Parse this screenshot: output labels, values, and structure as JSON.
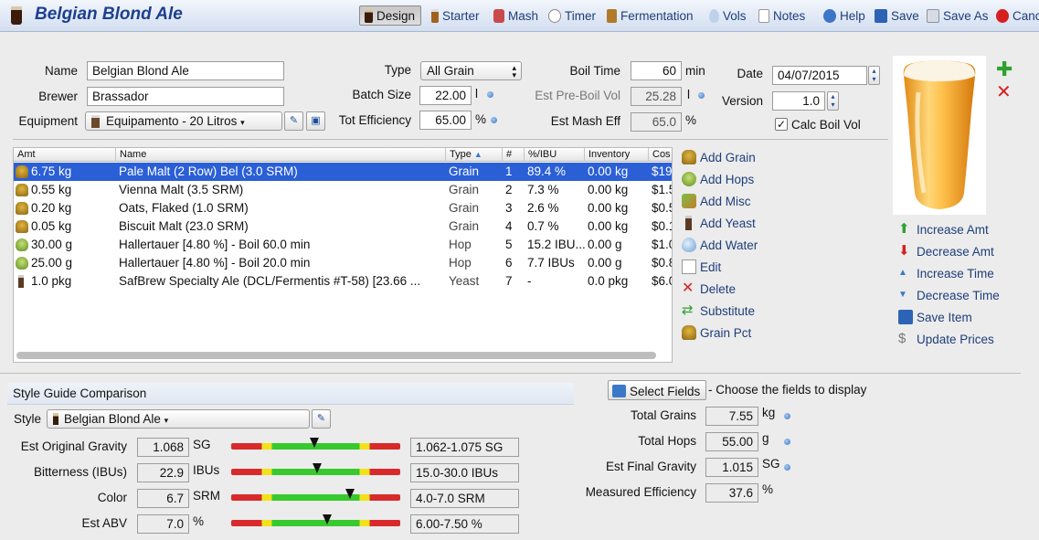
{
  "header": {
    "title": "Belgian Blond Ale",
    "toolbar": [
      {
        "label": "Design",
        "icon": "design-icon",
        "active": true
      },
      {
        "label": "Starter",
        "icon": "starter-icon"
      },
      {
        "label": "Mash",
        "icon": "mash-icon"
      },
      {
        "label": "Timer",
        "icon": "timer-icon"
      },
      {
        "label": "Fermentation",
        "icon": "fermentation-icon"
      },
      {
        "label": "Vols",
        "icon": "vols-icon"
      },
      {
        "label": "Notes",
        "icon": "notes-icon"
      },
      {
        "label": "Help",
        "icon": "help-icon"
      },
      {
        "label": "Save",
        "icon": "save-icon"
      },
      {
        "label": "Save As",
        "icon": "save-as-icon"
      },
      {
        "label": "Canc",
        "icon": "cancel-icon"
      }
    ]
  },
  "recipe": {
    "name_label": "Name",
    "name_value": "Belgian Blond Ale",
    "brewer_label": "Brewer",
    "brewer_value": "Brassador",
    "equipment_label": "Equipment",
    "equipment_value": "Equipamento - 20 Litros",
    "type_label": "Type",
    "type_value": "All Grain",
    "batch_label": "Batch Size",
    "batch_value": "22.00",
    "batch_unit": "l",
    "efficiency_label": "Tot Efficiency",
    "efficiency_value": "65.00",
    "efficiency_unit": "%",
    "boil_label": "Boil Time",
    "boil_value": "60",
    "boil_unit": "min",
    "preboil_label": "Est Pre-Boil Vol",
    "preboil_value": "25.28",
    "preboil_unit": "l",
    "mash_eff_label": "Est Mash Eff",
    "mash_eff_value": "65.0",
    "mash_eff_unit": "%",
    "date_label": "Date",
    "date_value": "04/07/2015",
    "version_label": "Version",
    "version_value": "1.0",
    "calc_boil_label": "Calc Boil Vol",
    "calc_boil_checked": true
  },
  "ingredients": {
    "columns": [
      "Amt",
      "Name",
      "Type",
      "#",
      "%/IBU",
      "Inventory",
      "Cos"
    ],
    "rows": [
      {
        "icon": "grain-icon",
        "amt": "6.75 kg",
        "name": "Pale Malt (2 Row) Bel (3.0 SRM)",
        "type": "Grain",
        "num": "1",
        "pct": "89.4 %",
        "inv": "0.00 kg",
        "cost": "$19",
        "selected": true
      },
      {
        "icon": "grain-icon",
        "amt": "0.55 kg",
        "name": "Vienna Malt (3.5 SRM)",
        "type": "Grain",
        "num": "2",
        "pct": "7.3 %",
        "inv": "0.00 kg",
        "cost": "$1.5"
      },
      {
        "icon": "grain-icon",
        "amt": "0.20 kg",
        "name": "Oats, Flaked (1.0 SRM)",
        "type": "Grain",
        "num": "3",
        "pct": "2.6 %",
        "inv": "0.00 kg",
        "cost": "$0.5"
      },
      {
        "icon": "grain-icon",
        "amt": "0.05 kg",
        "name": "Biscuit Malt (23.0 SRM)",
        "type": "Grain",
        "num": "4",
        "pct": "0.7 %",
        "inv": "0.00 kg",
        "cost": "$0.1"
      },
      {
        "icon": "hop-icon",
        "amt": "30.00 g",
        "name": "Hallertauer [4.80 %] - Boil 60.0 min",
        "type": "Hop",
        "num": "5",
        "pct": "15.2 IBU...",
        "inv": "0.00 g",
        "cost": "$1.0"
      },
      {
        "icon": "hop-icon",
        "amt": "25.00 g",
        "name": "Hallertauer [4.80 %] - Boil 20.0 min",
        "type": "Hop",
        "num": "6",
        "pct": "7.7 IBUs",
        "inv": "0.00 g",
        "cost": "$0.8"
      },
      {
        "icon": "yeast-icon",
        "amt": "1.0 pkg",
        "name": "SafBrew Specialty Ale (DCL/Fermentis #T-58) [23.66 ...",
        "type": "Yeast",
        "num": "7",
        "pct": "-",
        "inv": "0.0 pkg",
        "cost": "$6.0"
      }
    ]
  },
  "actions": [
    {
      "label": "Add Grain",
      "icon": "add-grain-icon"
    },
    {
      "label": "Add Hops",
      "icon": "add-hops-icon"
    },
    {
      "label": "Add Misc",
      "icon": "add-misc-icon"
    },
    {
      "label": "Add Yeast",
      "icon": "add-yeast-icon"
    },
    {
      "label": "Add Water",
      "icon": "add-water-icon"
    },
    {
      "label": "Edit",
      "icon": "edit-icon"
    },
    {
      "label": "Delete",
      "icon": "delete-icon"
    },
    {
      "label": "Substitute",
      "icon": "substitute-icon"
    },
    {
      "label": "Grain Pct",
      "icon": "grain-pct-icon"
    }
  ],
  "right_actions": [
    {
      "label": "Increase Amt",
      "icon": "arrow-up-icon"
    },
    {
      "label": "Decrease Amt",
      "icon": "arrow-down-icon"
    },
    {
      "label": "Increase Time",
      "icon": "triangle-up-icon"
    },
    {
      "label": "Decrease Time",
      "icon": "triangle-down-icon"
    },
    {
      "label": "Save Item",
      "icon": "save-item-icon"
    },
    {
      "label": "Update Prices",
      "icon": "dollar-icon"
    }
  ],
  "style": {
    "section_title": "Style Guide Comparison",
    "style_label": "Style",
    "style_value": "Belgian Blond Ale",
    "rows": [
      {
        "label": "Est Original Gravity",
        "value": "1.068",
        "unit": "SG",
        "range": "1.062-1.075 SG",
        "marker": 0.49
      },
      {
        "label": "Bitterness (IBUs)",
        "value": "22.9",
        "unit": "IBUs",
        "range": "15.0-30.0 IBUs",
        "marker": 0.51
      },
      {
        "label": "Color",
        "value": "6.7",
        "unit": "SRM",
        "range": "4.0-7.0 SRM",
        "marker": 0.7
      },
      {
        "label": "Est ABV",
        "value": "7.0",
        "unit": "%",
        "range": "6.00-7.50 %",
        "marker": 0.57
      }
    ]
  },
  "summary": {
    "select_fields_label": "Select Fields",
    "select_fields_hint": "- Choose the fields to display",
    "rows": [
      {
        "label": "Total Grains",
        "value": "7.55",
        "unit": "kg"
      },
      {
        "label": "Total Hops",
        "value": "55.00",
        "unit": "g"
      },
      {
        "label": "Est Final Gravity",
        "value": "1.015",
        "unit": "SG"
      },
      {
        "label": "Measured Efficiency",
        "value": "37.6",
        "unit": "%"
      }
    ]
  },
  "colors": {
    "accent": "#1f3e7a",
    "selection": "#2b5fd6",
    "title": "#1c3f8f"
  }
}
